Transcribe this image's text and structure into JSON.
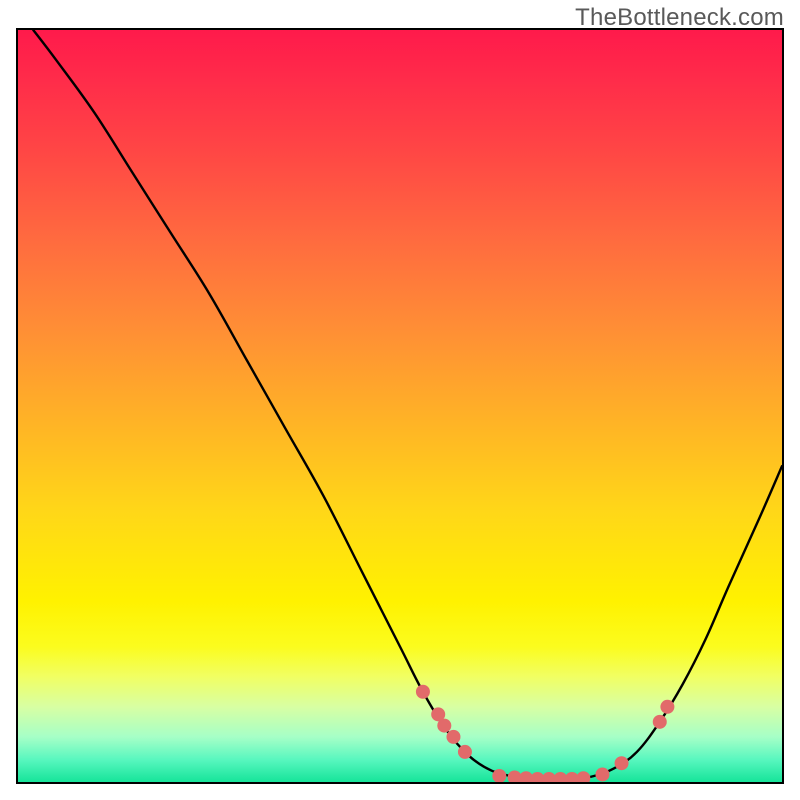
{
  "watermark": "TheBottleneck.com",
  "chart_data": {
    "type": "line",
    "title": "",
    "xlabel": "",
    "ylabel": "",
    "xlim": [
      0,
      100
    ],
    "ylim": [
      0,
      100
    ],
    "grid": false,
    "legend": false,
    "curve_points": [
      {
        "x": 2.0,
        "y": 100.0
      },
      {
        "x": 5.0,
        "y": 96.0
      },
      {
        "x": 10.0,
        "y": 89.0
      },
      {
        "x": 15.0,
        "y": 81.0
      },
      {
        "x": 20.0,
        "y": 73.0
      },
      {
        "x": 25.0,
        "y": 65.0
      },
      {
        "x": 30.0,
        "y": 56.0
      },
      {
        "x": 35.0,
        "y": 47.0
      },
      {
        "x": 40.0,
        "y": 38.0
      },
      {
        "x": 45.0,
        "y": 28.0
      },
      {
        "x": 50.0,
        "y": 18.0
      },
      {
        "x": 53.0,
        "y": 12.0
      },
      {
        "x": 56.0,
        "y": 7.0
      },
      {
        "x": 59.0,
        "y": 3.5
      },
      {
        "x": 62.0,
        "y": 1.5
      },
      {
        "x": 65.0,
        "y": 0.7
      },
      {
        "x": 68.0,
        "y": 0.3
      },
      {
        "x": 72.0,
        "y": 0.3
      },
      {
        "x": 75.0,
        "y": 0.7
      },
      {
        "x": 78.0,
        "y": 1.8
      },
      {
        "x": 81.0,
        "y": 4.0
      },
      {
        "x": 84.0,
        "y": 8.0
      },
      {
        "x": 87.0,
        "y": 13.0
      },
      {
        "x": 90.0,
        "y": 19.0
      },
      {
        "x": 93.0,
        "y": 26.0
      },
      {
        "x": 97.0,
        "y": 35.0
      },
      {
        "x": 100.0,
        "y": 42.0
      }
    ],
    "markers": [
      {
        "x": 53.0,
        "y": 12.0
      },
      {
        "x": 55.0,
        "y": 9.0
      },
      {
        "x": 55.8,
        "y": 7.5
      },
      {
        "x": 57.0,
        "y": 6.0
      },
      {
        "x": 58.5,
        "y": 4.0
      },
      {
        "x": 63.0,
        "y": 0.8
      },
      {
        "x": 65.0,
        "y": 0.6
      },
      {
        "x": 66.5,
        "y": 0.5
      },
      {
        "x": 68.0,
        "y": 0.4
      },
      {
        "x": 69.5,
        "y": 0.4
      },
      {
        "x": 71.0,
        "y": 0.4
      },
      {
        "x": 72.5,
        "y": 0.4
      },
      {
        "x": 74.0,
        "y": 0.5
      },
      {
        "x": 76.5,
        "y": 1.0
      },
      {
        "x": 79.0,
        "y": 2.5
      },
      {
        "x": 84.0,
        "y": 8.0
      },
      {
        "x": 85.0,
        "y": 10.0
      }
    ],
    "colors": {
      "curve": "#000000",
      "marker": "#e26a6a",
      "gradient_top": "#ff1a4b",
      "gradient_mid": "#ffd718",
      "gradient_bottom": "#16e49a"
    }
  }
}
